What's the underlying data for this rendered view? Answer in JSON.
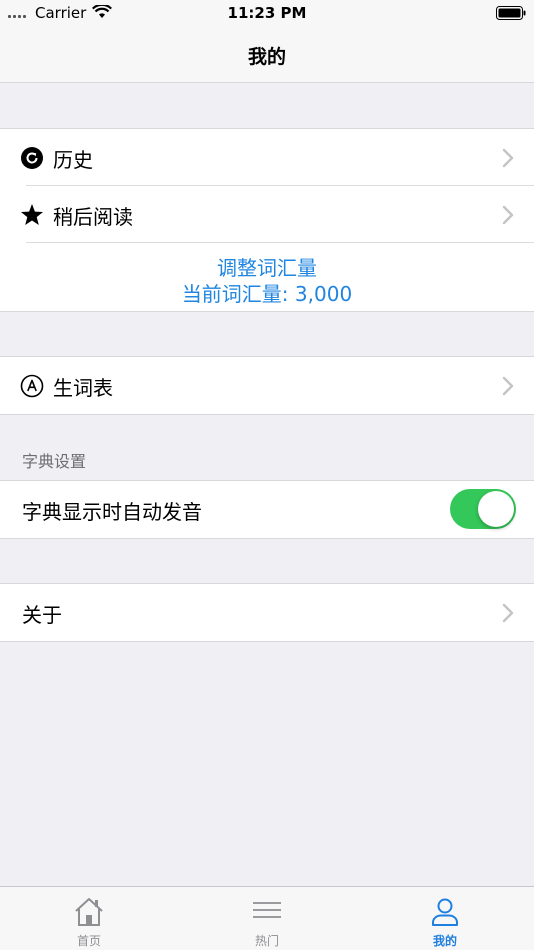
{
  "status_bar": {
    "carrier": "Carrier",
    "time": "11:23 PM"
  },
  "nav": {
    "title": "我的"
  },
  "group1": {
    "history_label": "历史",
    "read_later_label": "稍后阅读",
    "adjust_vocab_label": "调整词汇量",
    "current_vocab_label": "当前词汇量: 3,000"
  },
  "group2": {
    "wordlist_label": "生词表"
  },
  "dictionary_settings": {
    "header": "字典设置",
    "auto_pronounce_label": "字典显示时自动发音",
    "auto_pronounce_enabled": true
  },
  "group4": {
    "about_label": "关于"
  },
  "tab_bar": {
    "tabs": [
      {
        "label": "首页",
        "icon": "home-icon",
        "active": false
      },
      {
        "label": "热门",
        "icon": "list-icon",
        "active": false
      },
      {
        "label": "我的",
        "icon": "person-icon",
        "active": true
      }
    ]
  },
  "colors": {
    "accent": "#1f85e0",
    "toggle_on": "#34c759",
    "background": "#efeff4"
  }
}
